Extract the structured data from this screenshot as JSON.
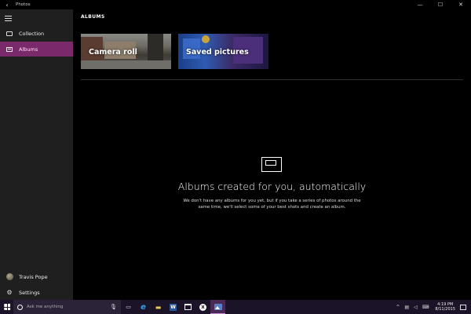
{
  "window": {
    "title": "Photos",
    "back_glyph": "‹",
    "minimize_glyph": "—",
    "maximize_glyph": "☐",
    "close_glyph": "✕"
  },
  "sidebar": {
    "items": [
      {
        "label": "Collection",
        "icon": "collection-icon",
        "selected": false
      },
      {
        "label": "Albums",
        "icon": "albums-icon",
        "selected": true
      }
    ],
    "user": {
      "name": "Travis Pope",
      "icon": "avatar"
    },
    "settings": {
      "label": "Settings",
      "icon": "gear-icon"
    }
  },
  "main": {
    "title": "ALBUMS",
    "tiles": [
      {
        "label": "Camera roll"
      },
      {
        "label": "Saved pictures"
      }
    ],
    "empty_state": {
      "heading": "Albums created for you, automatically",
      "body": "We don't have any albums for you yet, but if you take a series of photos around the same time, we'll select some of your best shots and create an album."
    }
  },
  "taskbar": {
    "search_placeholder": "Ask me anything",
    "clock_time": "4:19 PM",
    "clock_date": "8/11/2015",
    "accent": "#7a2a6a"
  }
}
